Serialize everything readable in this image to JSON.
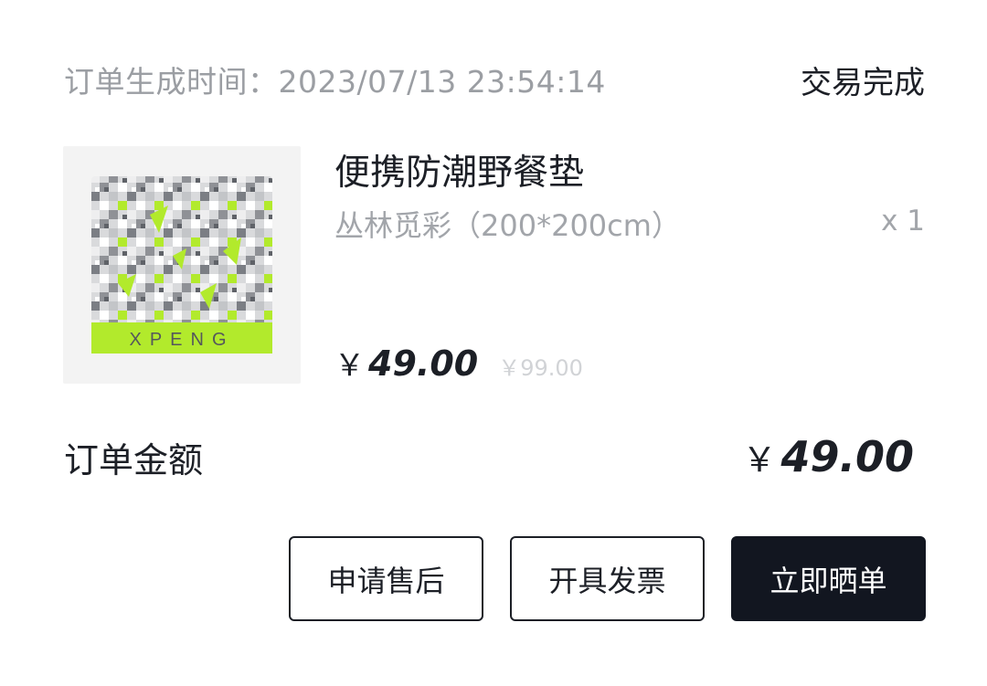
{
  "order": {
    "time_label": "订单生成时间：",
    "time_value": "2023/07/13 23:54:14",
    "status": "交易完成"
  },
  "product": {
    "name": "便携防潮野餐垫",
    "spec": "丛林觅彩（200*200cm）",
    "quantity": "x 1",
    "currency": "￥",
    "price": "49.00",
    "original_price": "￥99.00",
    "thumbnail_logo_text": "XPENG",
    "thumbnail_accent": "#b2ea2c"
  },
  "total": {
    "label": "订单金额",
    "currency": "￥",
    "amount": "49.00"
  },
  "actions": {
    "after_sale": "申请售后",
    "invoice": "开具发票",
    "share_review": "立即晒单"
  },
  "colors": {
    "text_primary": "#1c1f26",
    "text_muted": "#9b9ea3",
    "primary_button": "#121620"
  }
}
